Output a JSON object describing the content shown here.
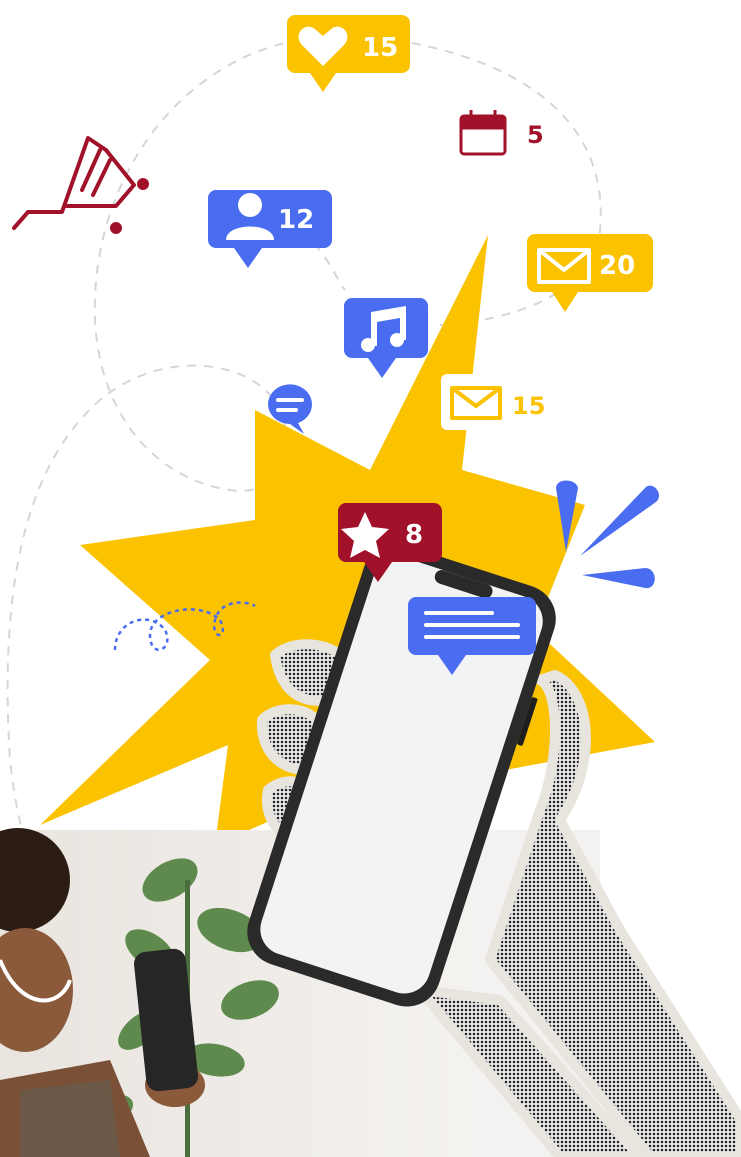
{
  "colors": {
    "yellow": "#FBC200",
    "blue": "#4A6CF0",
    "maroon": "#A1122A",
    "white": "#FFFFFF",
    "phone_frame": "#2A2A2A",
    "phone_screen": "#F2F3F4",
    "dash": "#D9D9D9"
  },
  "notifications": {
    "likes_count": "15",
    "calendar_count": "5",
    "followers_count": "12",
    "mail_large_count": "20",
    "mail_small_count": "15",
    "favorites_count": "8"
  },
  "icons": [
    "shopping-cart-icon",
    "heart-icon",
    "calendar-icon",
    "user-icon",
    "mail-icon",
    "music-note-icon",
    "chat-icon",
    "star-icon",
    "message-icon"
  ]
}
